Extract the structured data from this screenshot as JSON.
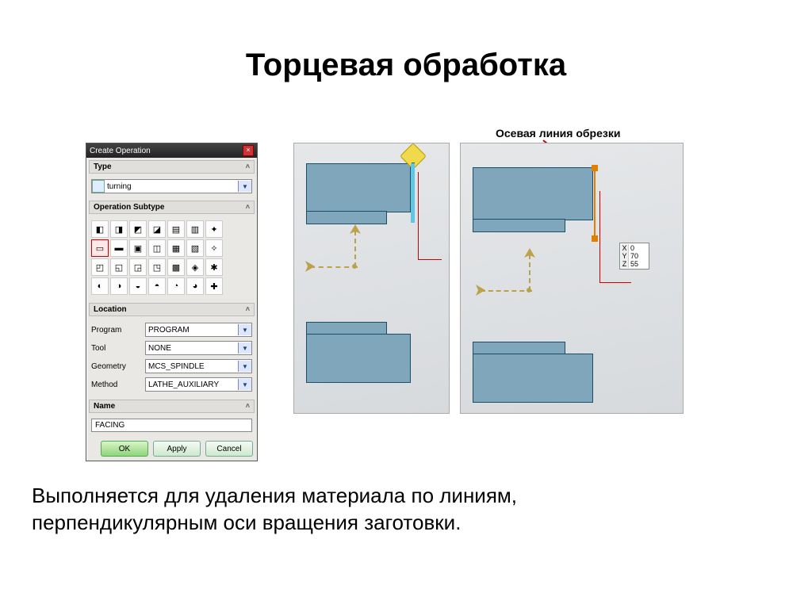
{
  "slide": {
    "title": "Торцевая обработка",
    "body_line1": "Выполняется для удаления материала по линиям,",
    "body_line2": "перпендикулярным оси вращения заготовки.",
    "annotation": "Осевая линия обрезки"
  },
  "dialog": {
    "title": "Create Operation",
    "sections": {
      "type": {
        "header": "Type",
        "value": "turning"
      },
      "subtype": {
        "header": "Operation Subtype",
        "icons": [
          "centerline-peck",
          "roughing",
          "finish",
          "groove",
          "thread",
          "drill",
          "teach",
          "face",
          "od-rough",
          "id-rough",
          "part-off",
          "od-finish",
          "id-finish",
          "misc",
          "cutoff",
          "od-groove",
          "id-groove",
          "od-thread",
          "id-thread",
          "ctr-drill",
          "ream",
          "bore",
          "tap",
          "spot",
          "user1",
          "user2",
          "user3",
          "user4"
        ],
        "selected_index": 7
      },
      "location": {
        "header": "Location",
        "rows": [
          {
            "label": "Program",
            "value": "PROGRAM"
          },
          {
            "label": "Tool",
            "value": "NONE"
          },
          {
            "label": "Geometry",
            "value": "MCS_SPINDLE"
          },
          {
            "label": "Method",
            "value": "LATHE_AUXILIARY"
          }
        ]
      },
      "name": {
        "header": "Name",
        "value": "FACING"
      }
    },
    "buttons": {
      "ok": "OK",
      "apply": "Apply",
      "cancel": "Cancel"
    }
  },
  "coords": {
    "x": {
      "label": "X",
      "value": "0"
    },
    "y": {
      "label": "Y",
      "value": "70"
    },
    "z": {
      "label": "Z",
      "value": "55"
    }
  },
  "icon_glyphs": [
    "◧",
    "◨",
    "◩",
    "◪",
    "▤",
    "▥",
    "✦",
    "▭",
    "▬",
    "▣",
    "◫",
    "▦",
    "▧",
    "✧",
    "◰",
    "◱",
    "◲",
    "◳",
    "▩",
    "◈",
    "✱",
    "◐",
    "◑",
    "◒",
    "◓",
    "◔",
    "◕",
    "✚"
  ]
}
